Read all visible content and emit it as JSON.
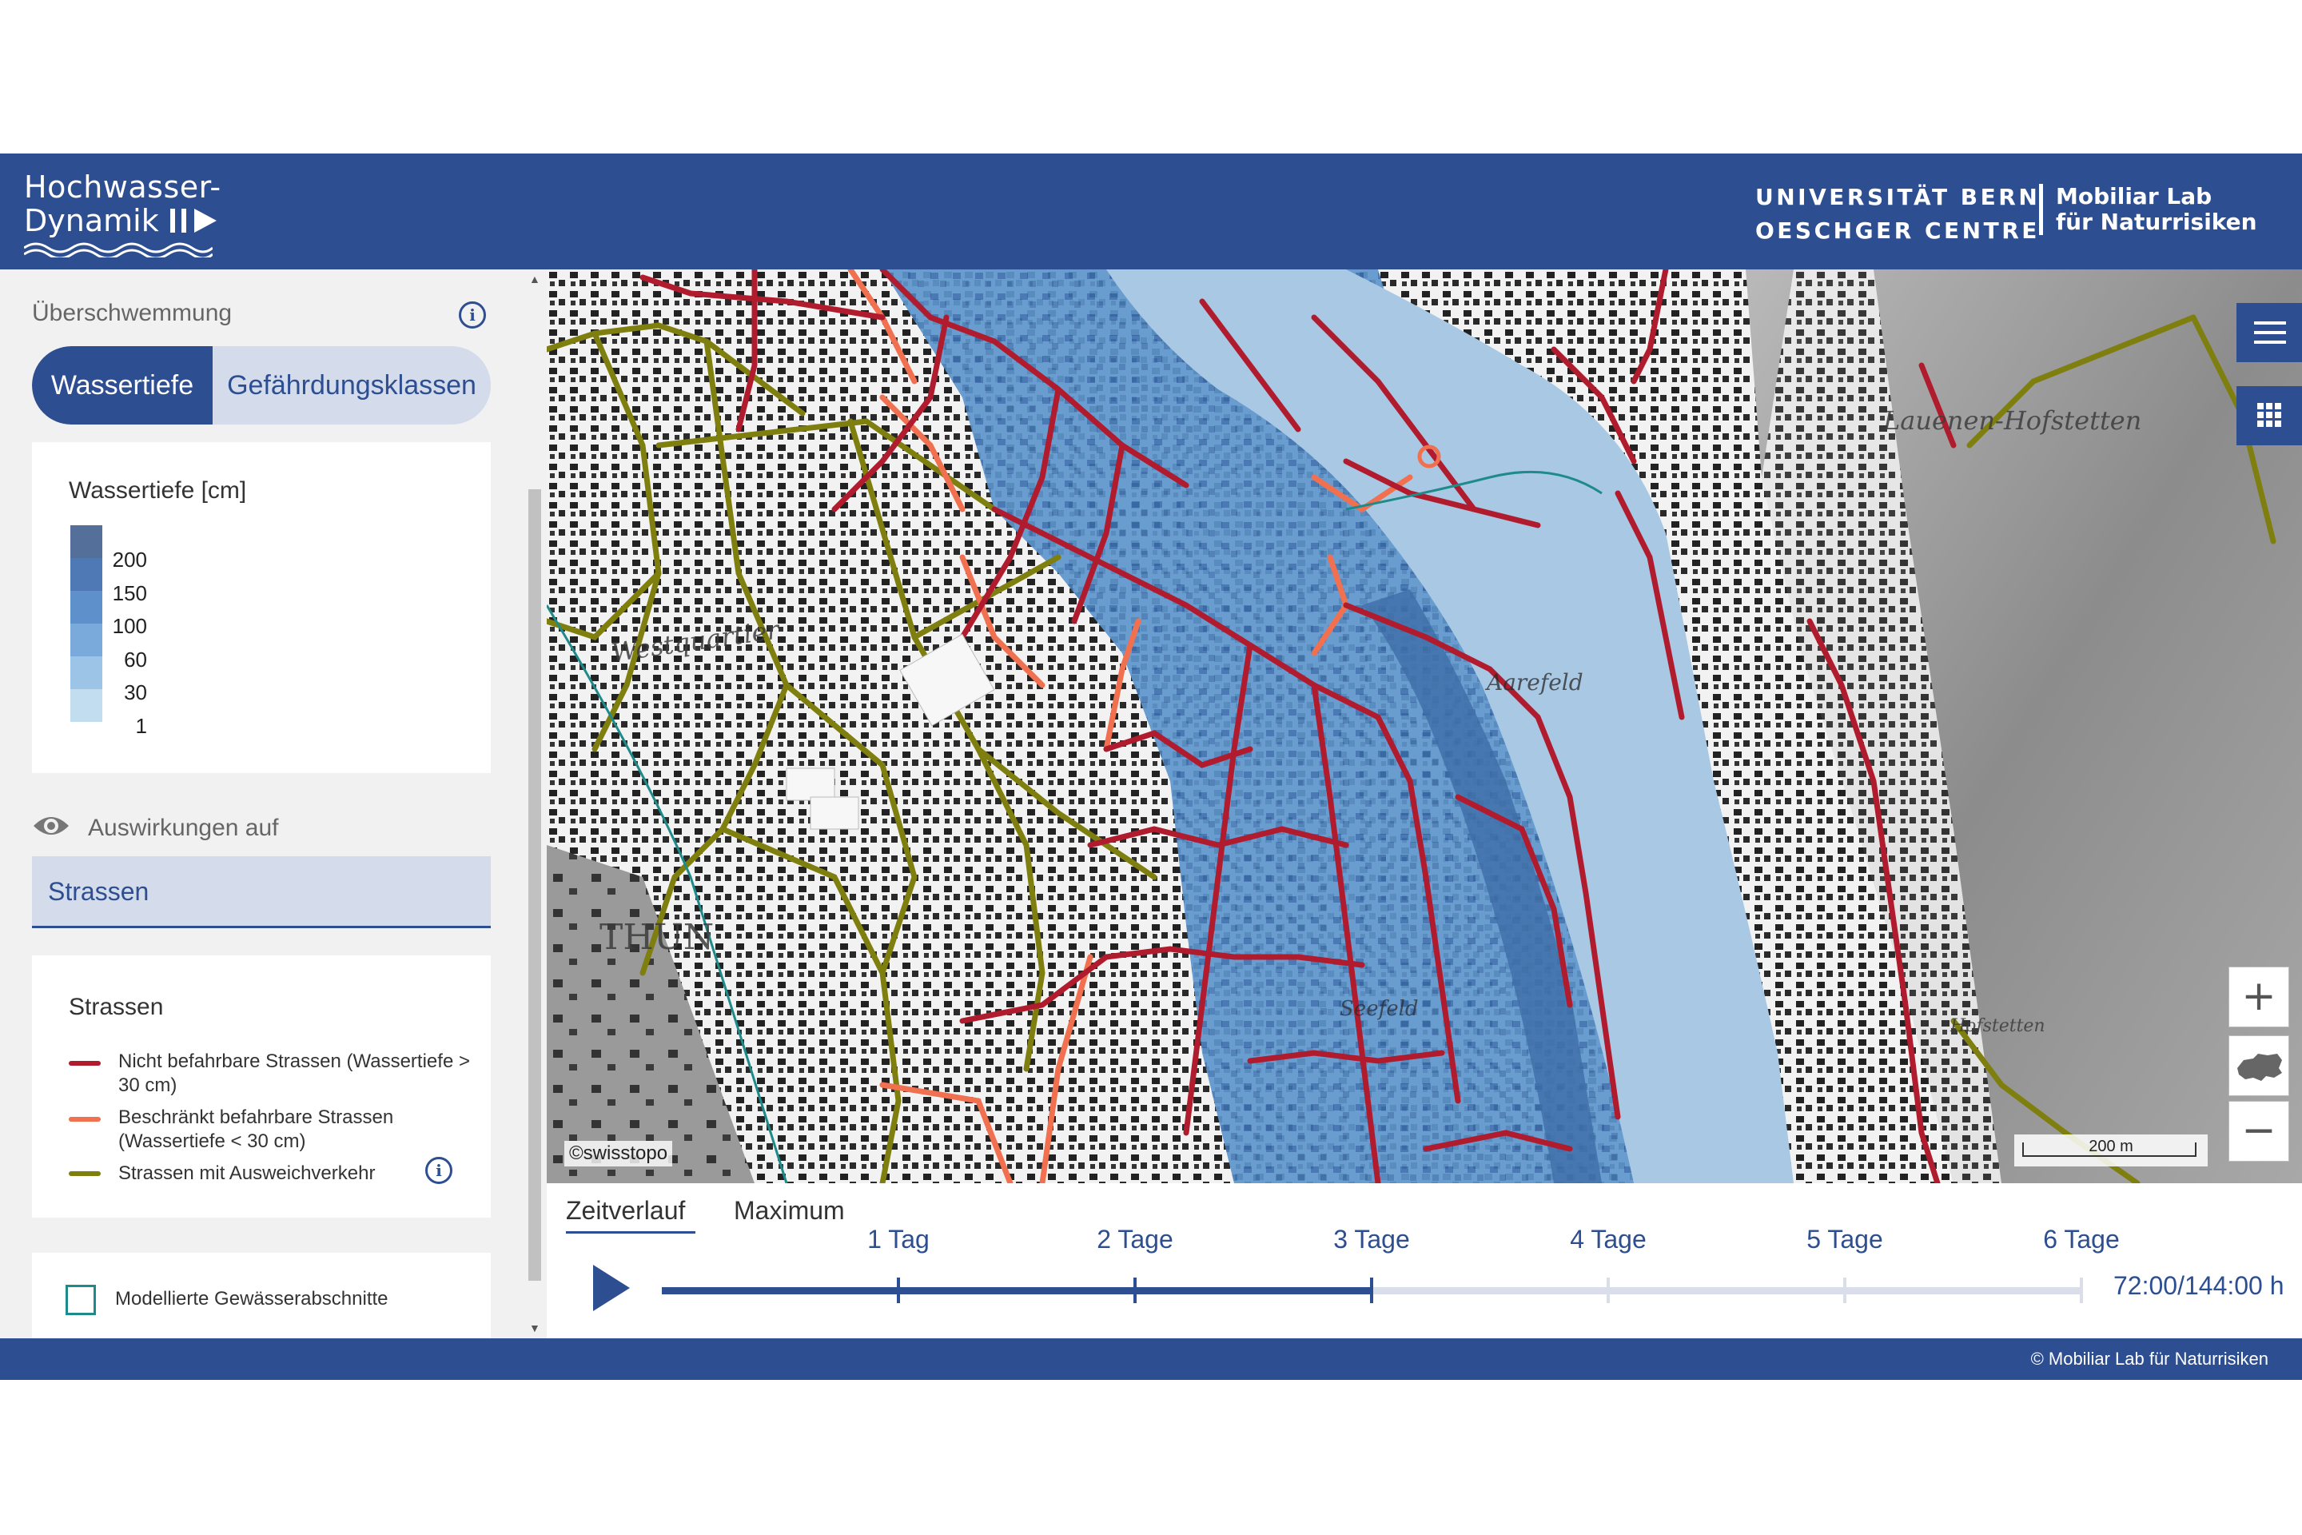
{
  "header": {
    "logo_line1": "Hochwasser-",
    "logo_line2": "Dynamik",
    "uni_line1": "UNIVERSITÄT BERN",
    "uni_line2": "OESCHGER CENTRE",
    "lab_line1": "Mobiliar Lab",
    "lab_line2": "für Naturrisiken"
  },
  "sidebar": {
    "section_title": "Überschwemmung",
    "toggle_active": "Wassertiefe",
    "toggle_inactive": "Gefährdungsklassen",
    "depth_legend": {
      "title": "Wassertiefe [cm]",
      "labels": [
        "200",
        "150",
        "100",
        "60",
        "30",
        "1"
      ],
      "colors": [
        "#54709a",
        "#4f79b4",
        "#5e91cb",
        "#79aadb",
        "#9cc4e6",
        "#c2dcf0"
      ]
    },
    "impact_title": "Auswirkungen auf",
    "impact_selected": "Strassen",
    "roads_legend": {
      "title": "Strassen",
      "items": [
        {
          "label": "Nicht befahrbare Strassen (Wassertiefe > 30 cm)",
          "color": "#b01c2e"
        },
        {
          "label": "Beschränkt befahrbare Strassen (Wassertiefe < 30 cm)",
          "color": "#f07050"
        },
        {
          "label": "Strassen mit Ausweichverkehr",
          "color": "#7f7f10"
        }
      ]
    },
    "checkbox_label": "Modellierte Gewässerabschnitte"
  },
  "map": {
    "attribution": "©swisstopo",
    "scale": "200 m",
    "places": [
      "Lauenen-Hofstetten",
      "Westquartier",
      "THUN",
      "Aarefeld",
      "Seefeld",
      "Hofstetten"
    ],
    "icons": [
      "menu-icon",
      "grid-icon",
      "zoom-in-icon",
      "switzerland-icon",
      "zoom-out-icon"
    ]
  },
  "timeline": {
    "tab_active": "Zeitverlauf",
    "tab_inactive": "Maximum",
    "days": [
      "1 Tag",
      "2 Tage",
      "3 Tage",
      "4 Tage",
      "5 Tage",
      "6 Tage"
    ],
    "progress": 0.5,
    "time_value": "72:00/144:00 h"
  },
  "footer": {
    "copyright": "© Mobiliar Lab für Naturrisiken"
  }
}
